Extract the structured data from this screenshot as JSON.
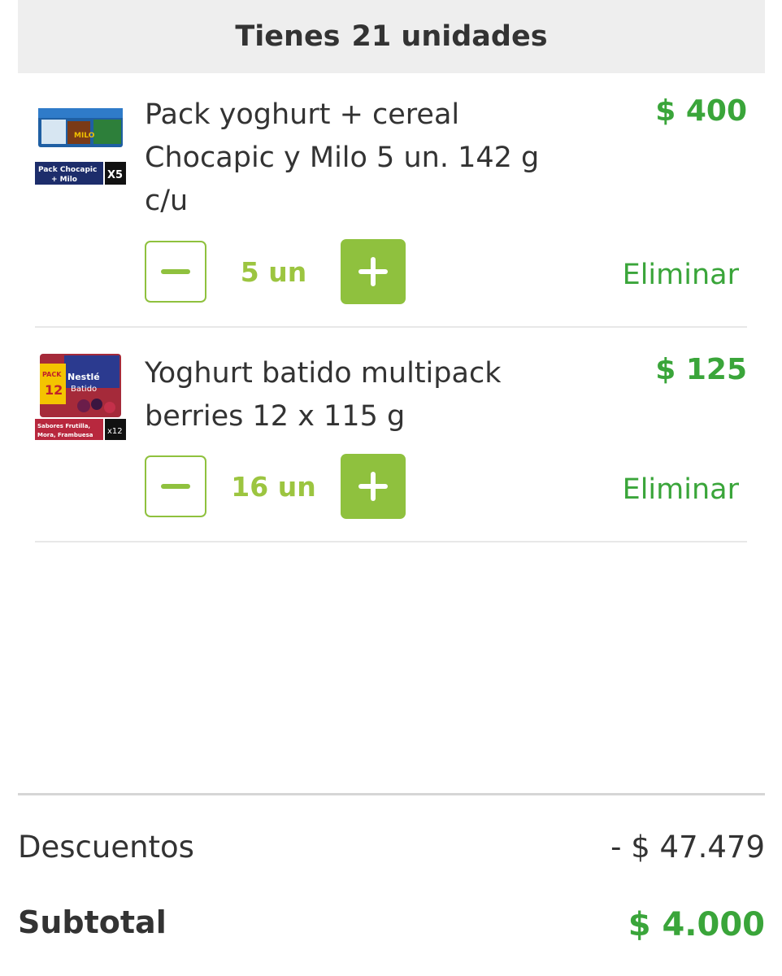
{
  "cart": {
    "header_prefix": "Tienes",
    "header_count": "21 unidades"
  },
  "items": [
    {
      "name": "Pack yoghurt + cereal Chocapic y Milo 5 un. 142 g c/u",
      "price": "$ 400",
      "quantity": "5 un",
      "remove_label": "Eliminar",
      "image": {
        "badge": "Pack Chocapic + Milo",
        "multiplier": "X5",
        "brand": "MILO"
      }
    },
    {
      "name": "Yoghurt batido multipack berries 12 x 115 g",
      "price": "$ 125",
      "quantity": "16 un",
      "remove_label": "Eliminar",
      "image": {
        "pack_label": "PACK AHORRO 12",
        "brand": "Nestlé",
        "product": "Batido",
        "flavors": "Sabores Frutilla, Mora, Frambuesa",
        "multiplier": "x12"
      }
    }
  ],
  "summary": {
    "discounts_label": "Descuentos",
    "discounts_value": "- $ 47.479",
    "subtotal_label": "Subtotal",
    "subtotal_value": "$ 4.000"
  },
  "colors": {
    "accent_green": "#8fc13e",
    "price_green": "#3aa53a",
    "header_bg": "#eeeeee"
  }
}
